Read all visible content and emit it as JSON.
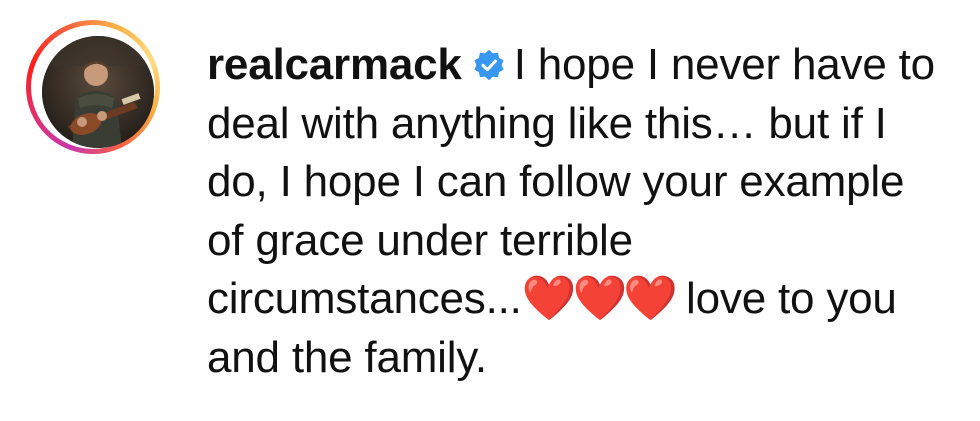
{
  "comment": {
    "username": "realcarmack",
    "verified_icon": "verified-badge-icon",
    "text_part1": "I hope I never have to deal with anything like this… but if I do, I hope I can follow your example of grace under terrible circumstances...",
    "hearts": "❤️❤️❤️",
    "text_part2": " love to you and the family."
  },
  "colors": {
    "verified_badge": "#3897f0",
    "heart": "#e8121f",
    "story_ring": [
      "#c837ab",
      "#e1306c",
      "#fd1d1d",
      "#f56040",
      "#fcaf45"
    ]
  }
}
